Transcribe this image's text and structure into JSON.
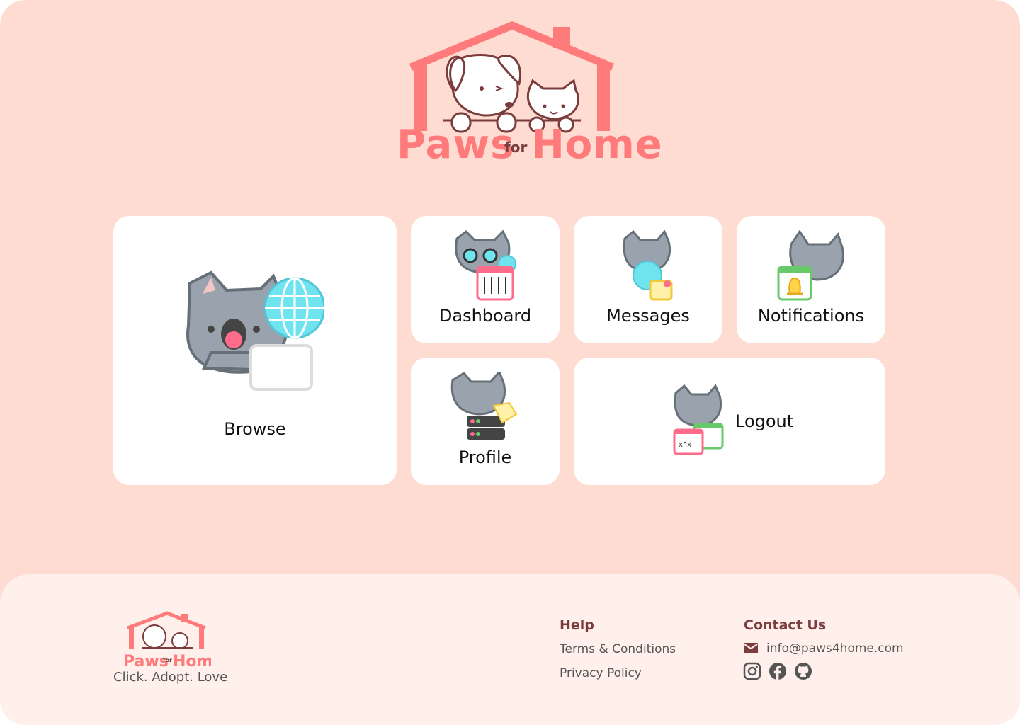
{
  "brand": {
    "paws": "Paws",
    "for": "for",
    "home": "Home"
  },
  "tiles": {
    "browse": "Browse",
    "dashboard": "Dashboard",
    "messages": "Messages",
    "notifications": "Notifications",
    "profile": "Profile",
    "logout": "Logout"
  },
  "footer": {
    "tagline": "Click. Adopt. Love",
    "help": {
      "title": "Help",
      "links": [
        "Terms & Conditions",
        "Privacy Policy"
      ]
    },
    "contact": {
      "title": "Contact Us",
      "email": "info@paws4home.com",
      "socials": [
        "instagram-icon",
        "facebook-icon",
        "github-icon"
      ]
    }
  },
  "colors": {
    "background": "#ffdcd2",
    "accent": "#ff7b7b",
    "brown": "#7a3c3c",
    "card": "#ffffff",
    "footer": "#fff0ec"
  }
}
